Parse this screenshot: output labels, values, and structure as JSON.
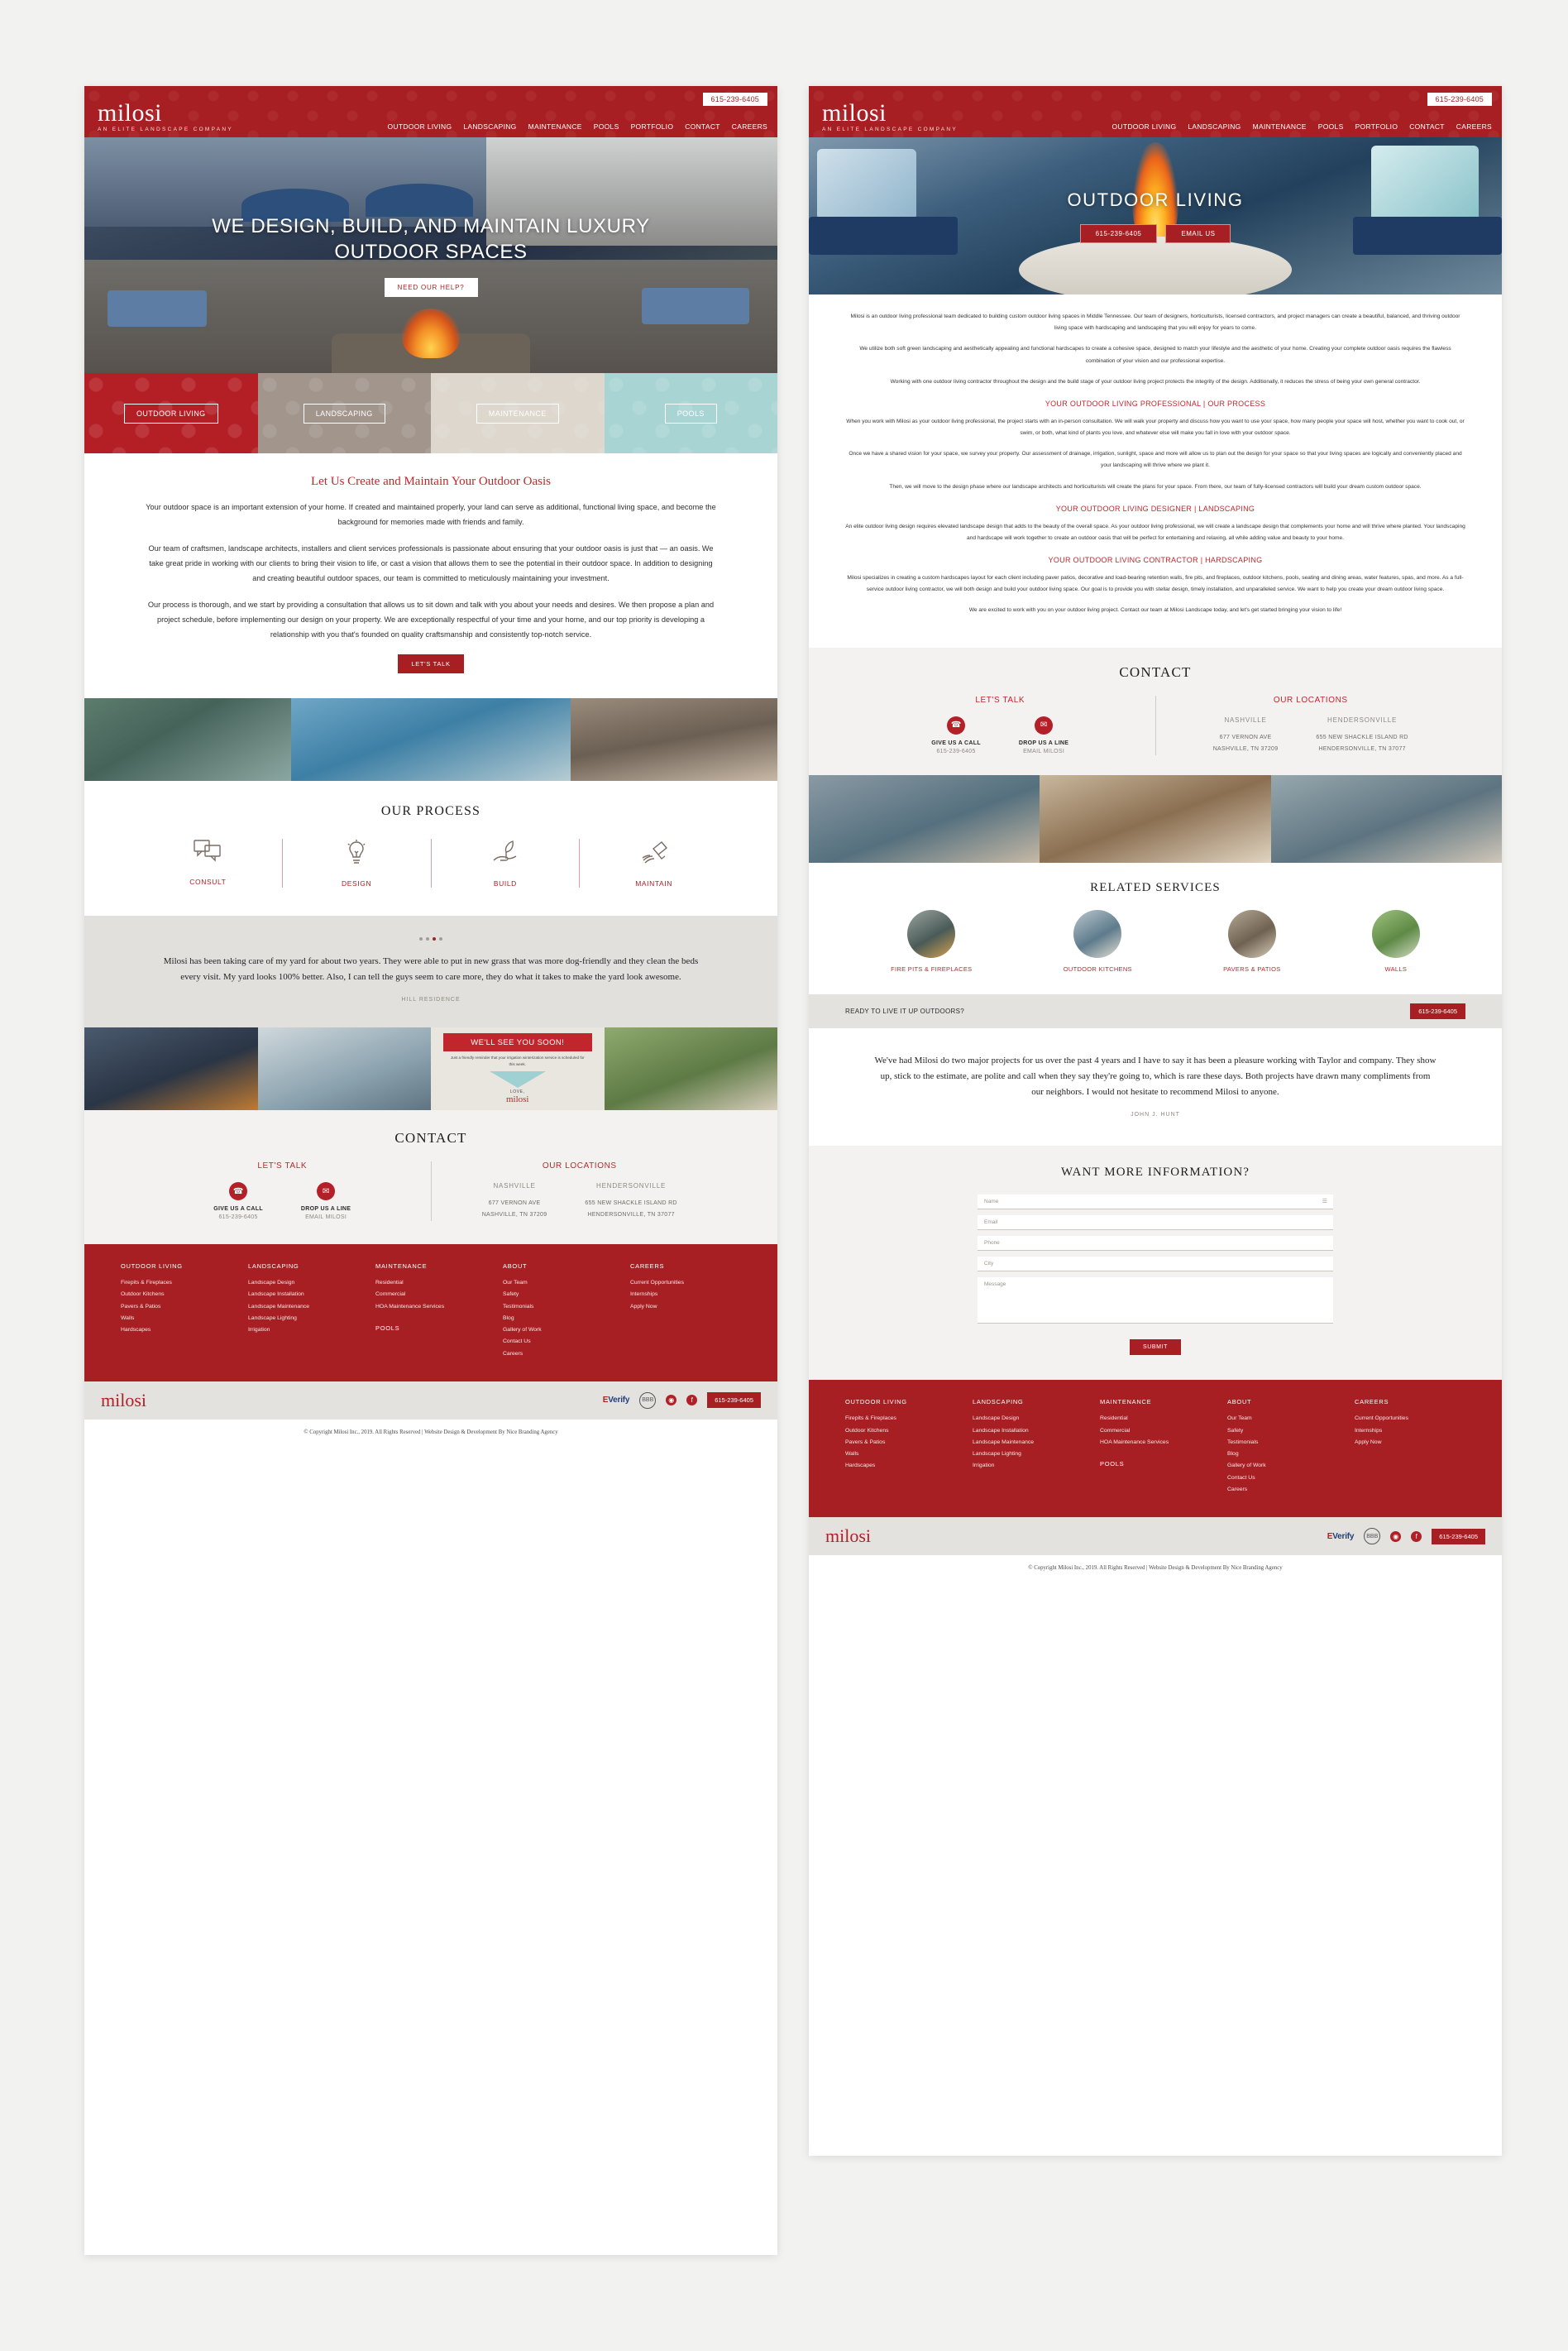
{
  "brand": {
    "name": "milosi",
    "tagline": "AN ELITE LANDSCAPE COMPANY",
    "phone": "615-239-6405",
    "accent_red": "#a81f23",
    "accent_red_light": "#c0262c"
  },
  "nav": {
    "items": [
      "OUTDOOR LIVING",
      "LANDSCAPING",
      "MAINTENANCE",
      "POOLS",
      "PORTFOLIO",
      "CONTACT",
      "CAREERS"
    ]
  },
  "left_page": {
    "hero": {
      "title": "WE DESIGN, BUILD, AND MAINTAIN LUXURY OUTDOOR SPACES",
      "button": "NEED OUR HELP?"
    },
    "tiles": [
      {
        "label": "OUTDOOR LIVING",
        "color": "#b41f26"
      },
      {
        "label": "LANDSCAPING",
        "color": "#a2958c"
      },
      {
        "label": "MAINTENANCE",
        "color": "#ddd7cd"
      },
      {
        "label": "POOLS",
        "color": "#a9d4d4"
      }
    ],
    "intro": {
      "heading": "Let Us Create and Maintain Your Outdoor Oasis",
      "p1": "Your outdoor space is an important extension of your home. If created and maintained properly, your land can serve as additional, functional living space, and become the background for memories made with friends and family.",
      "p2": "Our team of craftsmen, landscape architects, installers and client services professionals is passionate about ensuring that your outdoor oasis is just that — an oasis. We take great pride in working with our clients to bring their vision to life, or cast a vision that allows them to see the potential in their outdoor space. In addition to designing and creating beautiful outdoor spaces, our team is committed to meticulously maintaining your investment.",
      "p3": "Our process is thorough, and we start by providing a consultation that allows us to sit down and talk with you about your needs and desires. We then propose a plan and project schedule, before implementing our design on your property. We are exceptionally respectful of your time and your home, and our top priority is developing a relationship with you that's founded on quality craftsmanship and consistently top-notch service.",
      "button": "LET'S TALK"
    },
    "process": {
      "title": "OUR PROCESS",
      "steps": [
        {
          "label": "CONSULT",
          "icon": "speech-bubbles-icon"
        },
        {
          "label": "DESIGN",
          "icon": "lightbulb-icon"
        },
        {
          "label": "BUILD",
          "icon": "hand-plant-icon"
        },
        {
          "label": "MAINTAIN",
          "icon": "watering-can-icon"
        }
      ]
    },
    "testimonial": {
      "quote": "Milosi has been taking care of my yard for about two years. They were able to put in new grass that was more dog-friendly and they clean the beds every visit. My yard looks 100% better. Also, I can tell the guys seem to care more, they do what it takes to make the yard look awesome.",
      "author": "HILL RESIDENCE"
    },
    "postcard": {
      "headline": "WE'LL SEE YOU SOON!",
      "sub": "Just a friendly reminder that your irrigation winterization service is scheduled for this week.",
      "love": "LOVE,",
      "logo": "milosi"
    }
  },
  "right_page": {
    "hero": {
      "title": "OUTDOOR LIVING",
      "buttons": [
        "615-239-6405",
        "EMAIL US"
      ]
    },
    "body": {
      "p1": "Milosi is an outdoor living professional team dedicated to building custom outdoor living spaces in Middle Tennessee. Our team of designers, horticulturists, licensed contractors, and project managers can create a beautiful, balanced, and thriving outdoor living space with hardscaping and landscaping that you will enjoy for years to come.",
      "p2": "We utilize both soft green landscaping and aesthetically appealing and functional hardscapes to create a cohesive space, designed to match your lifestyle and the aesthetic of your home. Creating your complete outdoor oasis requires the flawless combination of your vision and our professional expertise.",
      "p3": "Working with one outdoor living contractor throughout the design and the build stage of your outdoor living project protects the integrity of the design. Additionally, it reduces the stress of being your own general contractor.",
      "h1": "YOUR OUTDOOR LIVING PROFESSIONAL | OUR PROCESS",
      "p4": "When you work with Milosi as your outdoor living professional, the project starts with an in-person consultation. We will walk your property and discuss how you want to use your space, how many people your space will host, whether you want to cook out, or swim, or both, what kind of plants you love, and whatever else will make you fall in love with your outdoor space.",
      "p5": "Once we have a shared vision for your space, we survey your property. Our assessment of drainage, irrigation, sunlight, space and more will allow us to plan out the design for your space so that your living spaces are logically and conveniently placed and your landscaping will thrive where we plant it.",
      "p6": "Then, we will move to the design phase where our landscape architects and horticulturists will create the plans for your space. From there, our team of fully-licensed contractors will build your dream custom outdoor space.",
      "h2": "YOUR OUTDOOR LIVING DESIGNER | LANDSCAPING",
      "p7": "An elite outdoor living design requires elevated landscape design that adds to the beauty of the overall space. As your outdoor living professional, we will create a landscape design that complements your home and will thrive where planted. Your landscaping and hardscape will work together to create an outdoor oasis that will be perfect for entertaining and relaxing, all while adding value and beauty to your home.",
      "h3": "YOUR OUTDOOR LIVING CONTRACTOR | HARDSCAPING",
      "p8": "Milosi specializes in creating a custom hardscapes layout for each client including paver patios, decorative and load-bearing retention walls, fire pits, and fireplaces, outdoor kitchens, pools, seating and dining areas, water features, spas, and more. As a full-service outdoor living contractor, we will both design and build your outdoor living space. Our goal is to provide you with stellar design, timely installation, and unparalleled service. We want to help you create your dream outdoor living space.",
      "p9": "We are excited to work with you on your outdoor living project. Contact our team at Milosi Landscape today, and let's get started bringing your vision to life!"
    },
    "related": {
      "title": "RELATED SERVICES",
      "items": [
        "FIRE PITS & FIREPLACES",
        "OUTDOOR KITCHENS",
        "PAVERS & PATIOS",
        "WALLS"
      ]
    },
    "cta_bar": {
      "text": "READY TO LIVE IT UP OUTDOORS?",
      "button": "615-239-6405"
    },
    "testimonial": {
      "quote": "We've had Milosi do two major projects for us over the past 4 years and I have to say it has been a pleasure working with Taylor and company. They show up, stick to the estimate, are polite and call when they say they're going to, which is rare these days. Both projects have drawn many compliments from our neighbors. I would not hesitate to recommend Milosi to anyone.",
      "author": "JOHN J. HUNT"
    },
    "form": {
      "title": "WANT MORE INFORMATION?",
      "fields": [
        "Name",
        "Email",
        "Phone",
        "City",
        "Message"
      ],
      "submit": "SUBMIT"
    }
  },
  "contact": {
    "title": "CONTACT",
    "lets_talk": "LET'S TALK",
    "our_locations": "OUR LOCATIONS",
    "call": {
      "label": "GIVE US A CALL",
      "value": "615-239-6405",
      "icon": "phone-icon"
    },
    "email": {
      "label": "DROP US A LINE",
      "value": "EMAIL MILOSI",
      "icon": "envelope-icon"
    },
    "locations": [
      {
        "city": "NASHVILLE",
        "street": "677 VERNON AVE",
        "citystate": "NASHVILLE, TN 37209"
      },
      {
        "city": "HENDERSONVILLE",
        "street": "655 NEW SHACKLE ISLAND RD",
        "citystate": "HENDERSONVILLE, TN 37077"
      }
    ]
  },
  "footer": {
    "columns": [
      {
        "heading": "OUTDOOR LIVING",
        "links": [
          "Firepits & Fireplaces",
          "Outdoor Kitchens",
          "Pavers & Patios",
          "Walls",
          "Hardscapes"
        ]
      },
      {
        "heading": "LANDSCAPING",
        "links": [
          "Landscape Design",
          "Landscape Installation",
          "Landscape Maintenance",
          "Landscape Lighting",
          "Irrigation"
        ]
      },
      {
        "heading": "MAINTENANCE",
        "links": [
          "Residential",
          "Commercial",
          "HOA Maintenance Services"
        ],
        "heading2": "POOLS"
      },
      {
        "heading": "ABOUT",
        "links": [
          "Our Team",
          "Safety",
          "Testimonials",
          "Blog",
          "Gallery of Work",
          "Contact Us",
          "Careers"
        ]
      },
      {
        "heading": "CAREERS",
        "links": [
          "Current Opportunities",
          "Internships",
          "Apply Now"
        ]
      }
    ],
    "bar": {
      "logo": "milosi",
      "everify_prefix": "E",
      "everify": "Verify",
      "seal": "BBB",
      "social": [
        "instagram-icon",
        "facebook-icon"
      ],
      "phone": "615-239-6405"
    },
    "copyright": "© Copyright Milosi Inc., 2019. All Rights Reserved | Website Design & Development By Nice Branding Agency"
  }
}
